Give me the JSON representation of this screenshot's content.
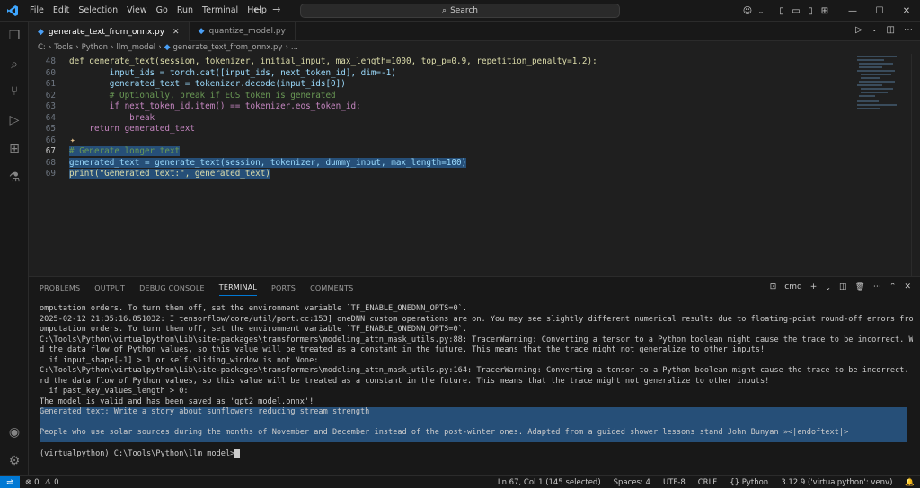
{
  "menu": [
    "File",
    "Edit",
    "Selection",
    "View",
    "Go",
    "Run",
    "Terminal",
    "Help"
  ],
  "search": {
    "label": "Search"
  },
  "tabs": [
    {
      "label": "generate_text_from_onnx.py",
      "active": true
    },
    {
      "label": "quantize_model.py",
      "active": false
    }
  ],
  "breadcrumb": [
    "C:",
    "Tools",
    "Python",
    "llm_model",
    "generate_text_from_onnx.py",
    "..."
  ],
  "editor": {
    "lines": [
      {
        "n": "48",
        "code": "def generate_text(session, tokenizer, initial_input, max_length=1000, top_p=0.9, repetition_penalty=1.2):"
      },
      {
        "n": "60",
        "code": "        input_ids = torch.cat([input_ids, next_token_id], dim=-1)"
      },
      {
        "n": "61",
        "code": "        generated_text = tokenizer.decode(input_ids[0])"
      },
      {
        "n": "62",
        "code": "        # Optionally, break if EOS token is generated"
      },
      {
        "n": "63",
        "code": "        if next_token_id.item() == tokenizer.eos_token_id:"
      },
      {
        "n": "64",
        "code": "            break"
      },
      {
        "n": "65",
        "code": "    return generated_text"
      },
      {
        "n": "66",
        "code": ""
      },
      {
        "n": "67",
        "code": "# Generate longer text"
      },
      {
        "n": "68",
        "code": "generated_text = generate_text(session, tokenizer, dummy_input, max_length=100)"
      },
      {
        "n": "69",
        "code": "print(\"Generated text:\", generated_text)"
      }
    ]
  },
  "panel": {
    "tabs": [
      "PROBLEMS",
      "OUTPUT",
      "DEBUG CONSOLE",
      "TERMINAL",
      "PORTS",
      "COMMENTS"
    ],
    "active_tab": "TERMINAL",
    "shell": "cmd"
  },
  "terminal": {
    "lines": [
      "omputation orders. To turn them off, set the environment variable `TF_ENABLE_ONEDNN_OPTS=0`.",
      "2025-02-12 21:35:16.851032: I tensorflow/core/util/port.cc:153] oneDNN custom operations are on. You may see slightly different numerical results due to floating-point round-off errors from different c",
      "omputation orders. To turn them off, set the environment variable `TF_ENABLE_ONEDNN_OPTS=0`.",
      "C:\\Tools\\Python\\virtualpython\\Lib\\site-packages\\transformers\\modeling_attn_mask_utils.py:88: TracerWarning: Converting a tensor to a Python boolean might cause the trace to be incorrect. We can't recor",
      "d the data flow of Python values, so this value will be treated as a constant in the future. This means that the trace might not generalize to other inputs!",
      "  if input_shape[-1] > 1 or self.sliding_window is not None:",
      "C:\\Tools\\Python\\virtualpython\\Lib\\site-packages\\transformers\\modeling_attn_mask_utils.py:164: TracerWarning: Converting a tensor to a Python boolean might cause the trace to be incorrect. We can't reco",
      "rd the data flow of Python values, so this value will be treated as a constant in the future. This means that the trace might not generalize to other inputs!",
      "  if past_key_values_length > 0:",
      "The model is valid and has been saved as 'gpt2_model.onnx'!"
    ],
    "selected_lines": [
      "Generated text: Write a story about sunflowers reducing stream strength",
      "",
      "People who use solar sources during the months of November and December instead of the post-winter ones. Adapted from a guided shower lessons stand John Bunyan »<|endoftext|>",
      ""
    ],
    "prompt": "(virtualpython) C:\\Tools\\Python\\llm_model>"
  },
  "status": {
    "errors": "0",
    "warnings": "0",
    "position": "Ln 67, Col 1 (145 selected)",
    "spaces": "Spaces: 4",
    "encoding": "UTF-8",
    "eol": "CRLF",
    "language": "Python",
    "interpreter": "3.12.9 ('virtualpython': venv)"
  },
  "colors": {
    "accent": "#0078d4",
    "selection": "#264f78",
    "background": "#1f1f1f"
  }
}
